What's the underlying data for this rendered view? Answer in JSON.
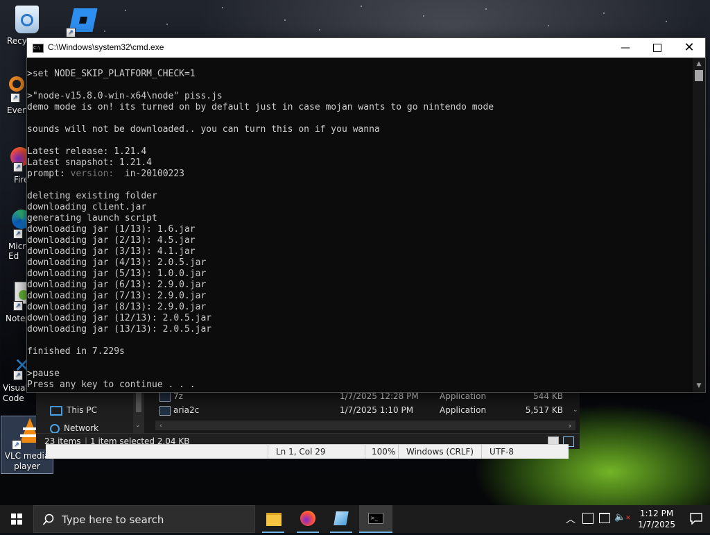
{
  "desktop": {
    "icons": [
      {
        "label": "Recycle Bin",
        "visible": "Recyc"
      },
      {
        "label": "Roblox",
        "visible": ""
      },
      {
        "label": "Everything",
        "visible": "Every"
      },
      {
        "label": "Firefox",
        "visible": "Fire"
      },
      {
        "label": "Microsoft Edge",
        "visible": "Micro\nEd"
      },
      {
        "label": "Notepad++",
        "visible": "Notep"
      },
      {
        "label": "Visual Studio Code",
        "visible": "Visual\nCode"
      },
      {
        "label": "VLC media player",
        "visible": "VLC media\nplayer"
      }
    ]
  },
  "cmd": {
    "title": "C:\\Windows\\system32\\cmd.exe",
    "lines": [
      ">set NODE_SKIP_PLATFORM_CHECK=1",
      "",
      ">\"node-v15.8.0-win-x64\\node\" piss.js",
      "demo mode is on! its turned on by default just in case mojan wants to go nintendo mode",
      "",
      "sounds will not be downloaded.. you can turn this on if you wanna",
      "",
      "Latest release: 1.21.4",
      "Latest snapshot: 1.21.4",
      "",
      "",
      "deleting existing folder",
      "downloading client.jar",
      "generating launch script",
      "downloading jar (1/13): 1.6.jar",
      "downloading jar (2/13): 4.5.jar",
      "downloading jar (3/13): 4.1.jar",
      "downloading jar (4/13): 2.0.5.jar",
      "downloading jar (5/13): 1.0.0.jar",
      "downloading jar (6/13): 2.9.0.jar",
      "downloading jar (7/13): 2.9.0.jar",
      "downloading jar (8/13): 2.9.0.jar",
      "downloading jar (12/13): 2.0.5.jar",
      "downloading jar (13/13): 2.0.5.jar",
      "",
      "finished in 7.229s",
      "",
      ">pause",
      "Press any key to continue . . ."
    ],
    "prompt_line": {
      "label": "prompt:",
      "dim_part": "version:",
      "value": "in-20100223"
    }
  },
  "explorer": {
    "nav": {
      "this_pc": "This PC",
      "network": "Network"
    },
    "files": [
      {
        "name": "7z",
        "date": "1/7/2025 12:28 PM",
        "type": "Application",
        "size": "544 KB"
      },
      {
        "name": "aria2c",
        "date": "1/7/2025 1:10 PM",
        "type": "Application",
        "size": "5,517 KB"
      }
    ],
    "status": {
      "items": "23 items",
      "selected": "1 item selected  2.04 KB"
    }
  },
  "notepad_status": {
    "position": "Ln 1, Col 29",
    "zoom": "100%",
    "eol": "Windows (CRLF)",
    "encoding": "UTF-8"
  },
  "taskbar": {
    "search_placeholder": "Type here to search",
    "time": "1:12 PM",
    "date": "1/7/2025"
  }
}
